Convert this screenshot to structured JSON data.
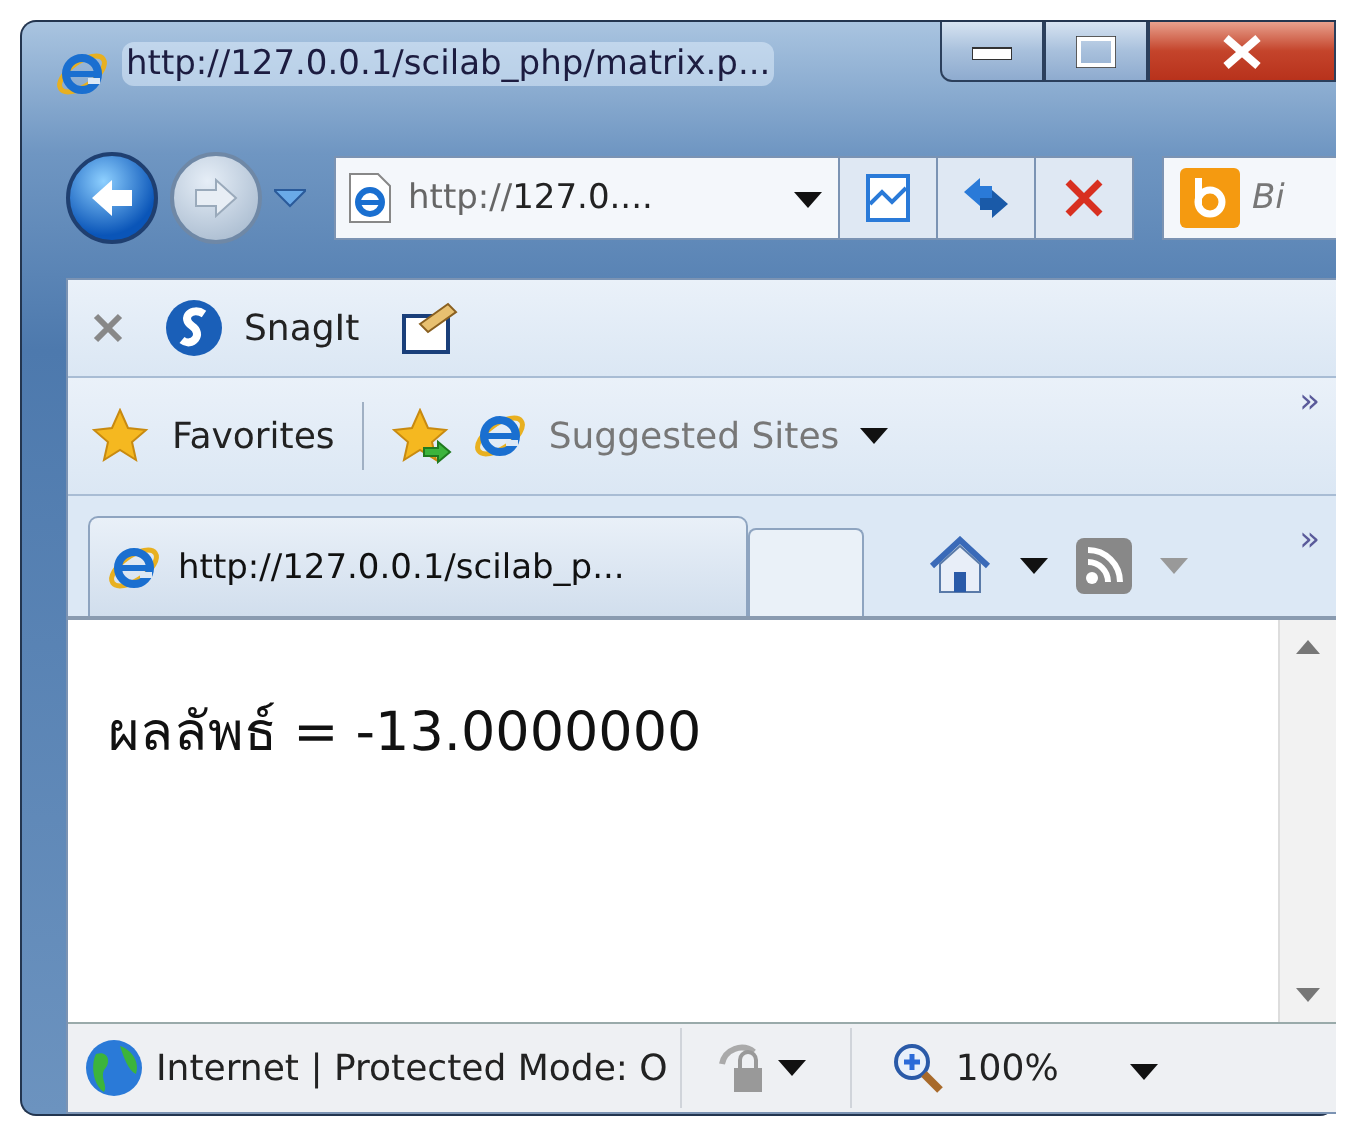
{
  "window": {
    "title": "http://127.0.0.1/scilab_php/matrix.p..."
  },
  "navigation": {
    "address": "http://**127.0....**",
    "search_placeholder": "Bi"
  },
  "command_bar": {
    "snagit": "SnagIt"
  },
  "favorites_bar": {
    "favorites": "Favorites",
    "suggested_sites": "Suggested Sites",
    "chevron": "»"
  },
  "tabs": [
    {
      "label": "http://127.0.0.1/scilab_p...",
      "selected": true
    }
  ],
  "tab_row": {
    "chevron": "»"
  },
  "content": {
    "text": "ผลลัพธ์ = -13.0000000"
  },
  "status_bar": {
    "zone": "Internet | Protected Mode: O",
    "zoom": "100%"
  }
}
